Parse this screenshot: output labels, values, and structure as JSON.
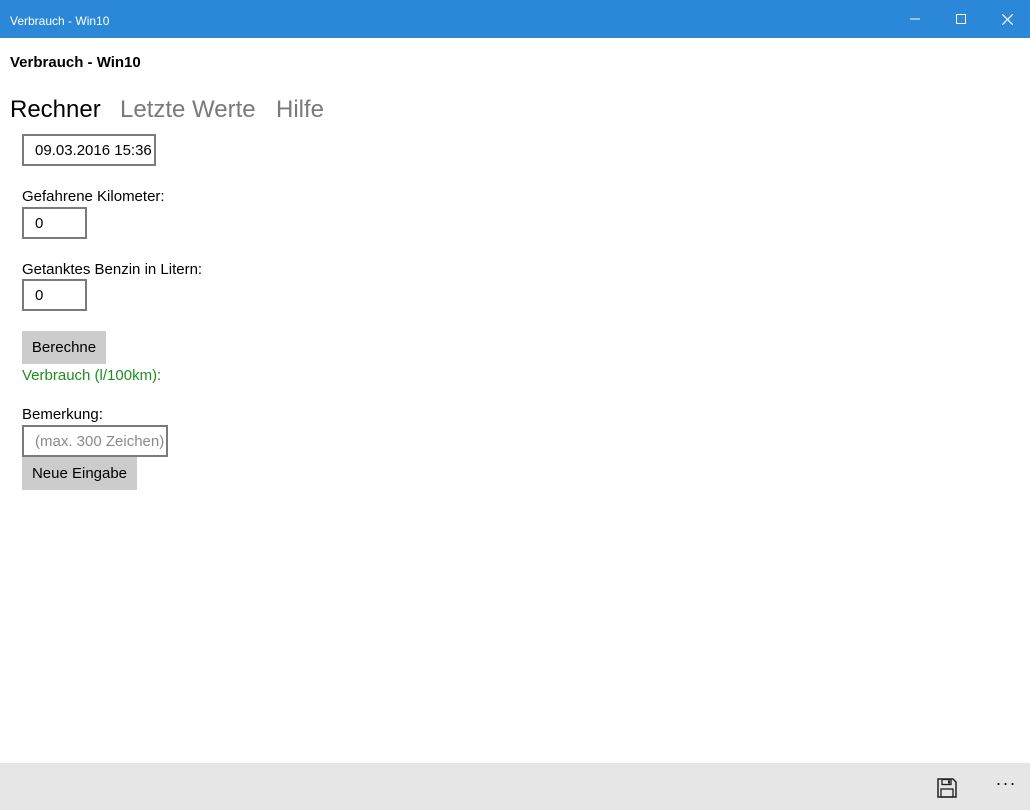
{
  "window": {
    "title": "Verbrauch - Win10",
    "titlebar_color": "#2b88d8",
    "controls": [
      "minimize-icon",
      "maximize-icon",
      "close-icon"
    ]
  },
  "app": {
    "title": "Verbrauch - Win10"
  },
  "tabs": [
    {
      "label": "Rechner",
      "active": true
    },
    {
      "label": "Letzte Werte",
      "active": false
    },
    {
      "label": "Hilfe",
      "active": false
    }
  ],
  "form": {
    "date_value": "09.03.2016 15:36",
    "km_label": "Gefahrene Kilometer:",
    "km_value": "0",
    "liter_label": "Getanktes Benzin in Litern:",
    "liter_value": "0",
    "calc_button": "Berechne",
    "result_label": "Verbrauch (l/100km):",
    "result_color": "#1e8f1e",
    "remark_label": "Bemerkung:",
    "remark_placeholder": "(max. 300 Zeichen)",
    "new_button": "Neue Eingabe"
  },
  "commandbar": {
    "icons": [
      "save-icon",
      "more-icon"
    ],
    "more_label": "···"
  }
}
